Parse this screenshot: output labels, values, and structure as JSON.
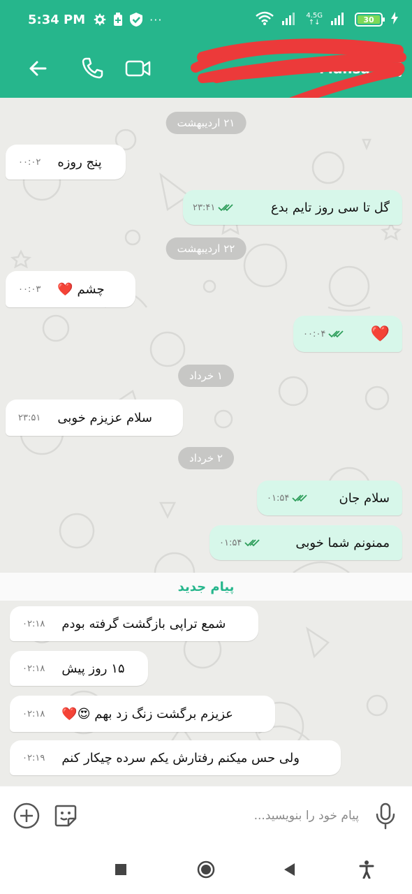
{
  "status_bar": {
    "time": "5:34 PM",
    "ellipsis": "···",
    "network_label": "4.5G",
    "battery_level": "30"
  },
  "toolbar": {
    "contact_name": "Mahsa"
  },
  "messages": [
    {
      "type": "date",
      "text": "۲۱ اردیبهشت"
    },
    {
      "type": "in",
      "text": "پنج روزه",
      "time": "۰۰:۰۲"
    },
    {
      "type": "out",
      "text": "گل تا سی روز تایم بدع",
      "time": "۲۳:۴۱"
    },
    {
      "type": "date",
      "text": "۲۲ اردیبهشت"
    },
    {
      "type": "in",
      "text": "چشم ❤️",
      "time": "۰۰:۰۳"
    },
    {
      "type": "out",
      "text": "❤️",
      "time": "۰۰:۰۴"
    },
    {
      "type": "date",
      "text": "۱ خرداد"
    },
    {
      "type": "in",
      "text": "سلام عزیزم خوبی",
      "time": "۲۳:۵۱"
    },
    {
      "type": "date",
      "text": "۲ خرداد"
    },
    {
      "type": "out",
      "text": "سلام جان",
      "time": "۰۱:۵۴"
    },
    {
      "type": "out",
      "text": "ممنونم شما خوبی",
      "time": "۰۱:۵۴"
    },
    {
      "type": "divider",
      "text": "پیام جدید"
    },
    {
      "type": "in",
      "text": "شمع تراپی بازگشت گرفته بودم",
      "time": "۰۲:۱۸"
    },
    {
      "type": "in",
      "text": "۱۵ روز پیش",
      "time": "۰۲:۱۸"
    },
    {
      "type": "in",
      "text": "عزیزم برگشت زنگ زد بهم 😍❤️",
      "time": "۰۲:۱۸"
    },
    {
      "type": "in",
      "text": "ولی حس میکنم رفتارش یکم سرده چیکار کنم",
      "time": "۰۲:۱۹"
    }
  ],
  "composer": {
    "placeholder": "پیام خود را بنویسید..."
  },
  "colors": {
    "brand": "#26b68c",
    "chat_bg": "#ecece9",
    "outgoing_bubble": "#d7f7ea",
    "incoming_bubble": "#ffffff",
    "date_pill": "#c7c7c5",
    "read_check": "#2e9e5b"
  },
  "icons": {
    "back": "arrow-left-icon",
    "call": "phone-icon",
    "video": "video-camera-icon",
    "menu": "more-vertical-icon",
    "attach": "plus-circle-icon",
    "sticker": "sticker-icon",
    "mic": "microphone-icon",
    "read": "double-check-icon"
  }
}
